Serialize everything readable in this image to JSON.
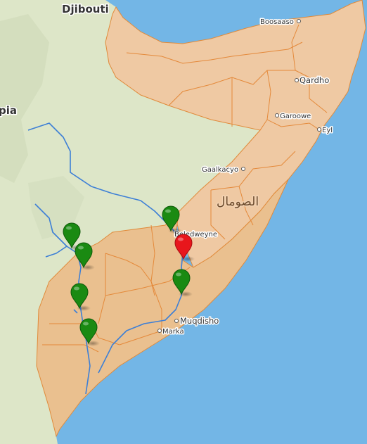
{
  "map": {
    "place_labels": [
      {
        "id": "djibouti",
        "text": "Djibouti"
      },
      {
        "id": "ethiopia",
        "text": "pia"
      },
      {
        "id": "boosaaso",
        "text": "Boosaaso"
      },
      {
        "id": "qardho",
        "text": "Qardho"
      },
      {
        "id": "garoowe",
        "text": "Garoowe"
      },
      {
        "id": "eyl",
        "text": "Eyl"
      },
      {
        "id": "gaalkacyo",
        "text": "Gaalkacyo"
      },
      {
        "id": "somalia",
        "text": "الصومال"
      },
      {
        "id": "beledweyne",
        "text": "Beledweyne"
      },
      {
        "id": "muqdisho",
        "text": "Muqdisho"
      },
      {
        "id": "marka",
        "text": "Marka"
      }
    ],
    "markers": [
      {
        "id": "marker-1",
        "status": "green",
        "color": "#1a8a12"
      },
      {
        "id": "marker-2",
        "status": "green",
        "color": "#1a8a12"
      },
      {
        "id": "marker-3",
        "status": "green",
        "color": "#1a8a12"
      },
      {
        "id": "marker-4",
        "status": "green",
        "color": "#1a8a12"
      },
      {
        "id": "marker-5",
        "status": "green",
        "color": "#1a8a12"
      },
      {
        "id": "marker-6",
        "status": "green",
        "color": "#1a8a12"
      },
      {
        "id": "marker-7",
        "status": "red",
        "color": "#e8161c"
      }
    ],
    "colors": {
      "water": "#73b6e6",
      "land": "#dde8c8",
      "somalia_fill": "#efc9a3",
      "somalia_south_fill": "#eac08f",
      "boundary": "#e4893a",
      "river": "#3d7fd6"
    }
  }
}
